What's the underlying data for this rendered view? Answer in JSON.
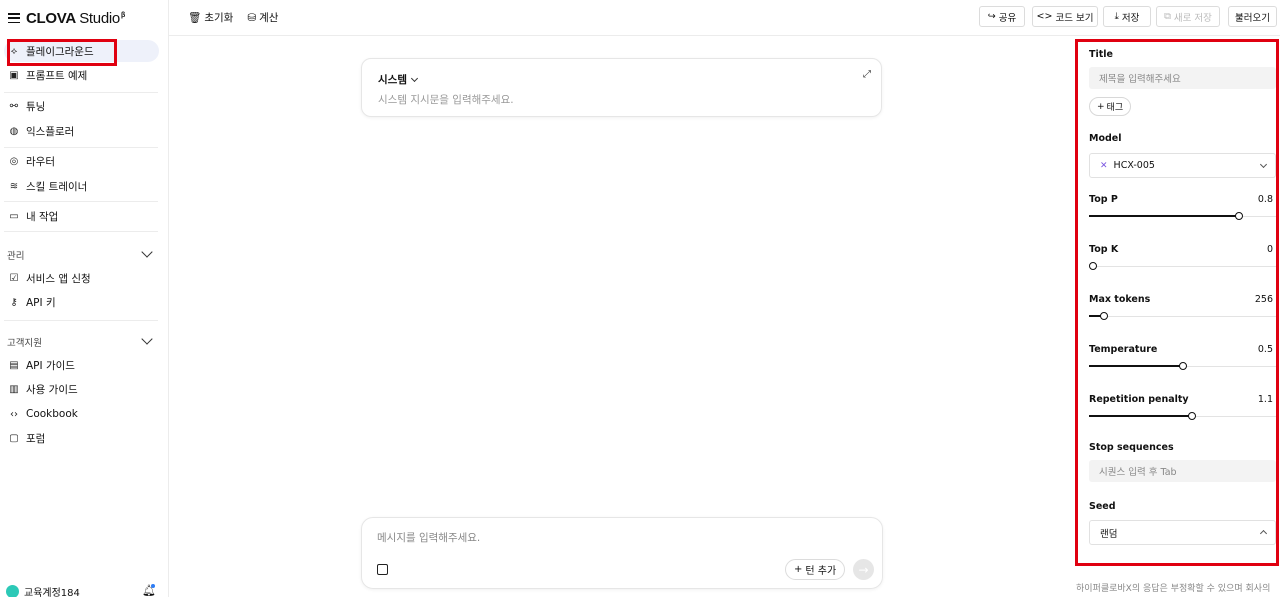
{
  "brand": {
    "name": "CLOVA",
    "studio": "Studio",
    "sup": "β"
  },
  "sidebar": {
    "items": [
      {
        "label": "플레이그라운드",
        "icon": "playground-icon"
      },
      {
        "label": "프롬프트 예제",
        "icon": "prompt-example-icon"
      },
      {
        "label": "튜닝",
        "icon": "tuning-icon"
      },
      {
        "label": "익스플로러",
        "icon": "explorer-icon"
      },
      {
        "label": "라우터",
        "icon": "router-icon"
      },
      {
        "label": "스킬 트레이너",
        "icon": "skill-trainer-icon"
      },
      {
        "label": "내 작업",
        "icon": "folder-icon"
      }
    ],
    "section_manage": {
      "label": "관리",
      "items": [
        {
          "label": "서비스 앱 신청"
        },
        {
          "label": "API 키"
        }
      ]
    },
    "section_support": {
      "label": "고객지원",
      "items": [
        {
          "label": "API 가이드"
        },
        {
          "label": "사용 가이드"
        },
        {
          "label": "Cookbook"
        },
        {
          "label": "포럼"
        }
      ]
    },
    "user": {
      "name": "교육계정184"
    }
  },
  "toolbar": {
    "reset": "초기화",
    "calculate": "계산",
    "share": "공유",
    "code_view": "코드 보기",
    "save": "저장",
    "save_as": "새로 저장",
    "load": "불러오기"
  },
  "main": {
    "system": {
      "title": "시스템",
      "placeholder": "시스템 지시문을 입력해주세요."
    },
    "message": {
      "placeholder": "메시지를 입력해주세요.",
      "add_turn": "턴 추가"
    }
  },
  "panel": {
    "title_label": "Title",
    "title_placeholder": "제목을 입력해주세요",
    "tag_button": "태그",
    "model_label": "Model",
    "model_value": "HCX-005",
    "params": [
      {
        "label": "Top P",
        "value": "0.8",
        "fraction": 0.8
      },
      {
        "label": "Top K",
        "value": "0",
        "fraction": 0.0
      },
      {
        "label": "Max tokens",
        "value": "256",
        "fraction": 0.08
      },
      {
        "label": "Temperature",
        "value": "0.5",
        "fraction": 0.5
      },
      {
        "label": "Repetition penalty",
        "value": "1.1",
        "fraction": 0.55
      }
    ],
    "stop_label": "Stop sequences",
    "stop_placeholder": "시퀀스 입력 후 Tab",
    "seed_label": "Seed",
    "seed_value": "랜덤",
    "disclaimer": "하이퍼클로바X의 응답은 부정확할 수 있으며 회사의"
  },
  "colors": {
    "highlight_red": "#e00010",
    "active_bg": "#eef1fa",
    "avatar": "#2cc9b7"
  }
}
